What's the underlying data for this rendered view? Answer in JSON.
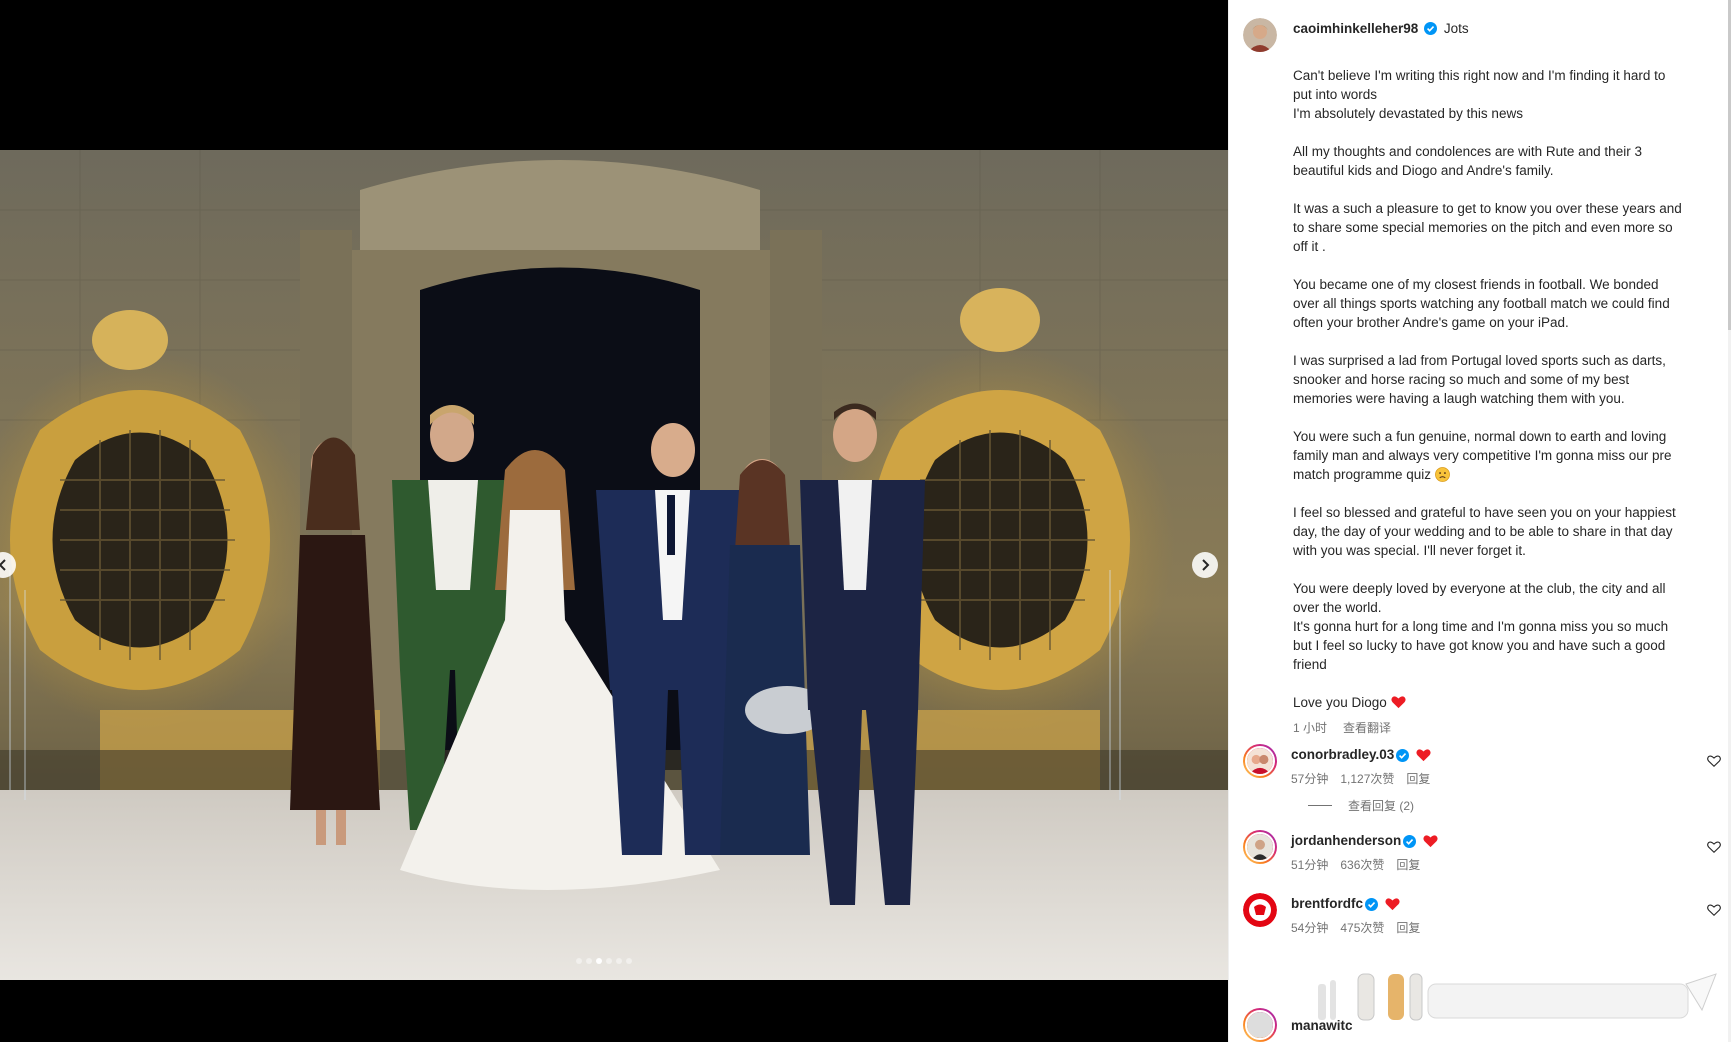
{
  "post": {
    "author": "caoimhinkelleher98",
    "title": "Jots",
    "paragraphs": [
      [
        "Can't believe I'm writing this right now and I'm finding it hard to",
        "put into words",
        "I'm absolutely devastated by this news"
      ],
      [
        "All my thoughts and condolences are with Rute and their 3",
        "beautiful kids and Diogo and Andre's family."
      ],
      [
        "It was a such a pleasure to get to know you over these years and",
        "to share some special memories on the pitch and even more so",
        "off it ."
      ],
      [
        "You became one of my closest friends in football. We bonded",
        "over all things sports watching any football match we could find",
        "often your brother Andre's game on your iPad."
      ],
      [
        "I was surprised a lad from Portugal loved sports such as darts,",
        "snooker and horse racing so much and some of my best",
        "memories were having a laugh watching them with you."
      ],
      [
        "You were such a fun genuine, normal down to earth and loving",
        "family man and always very competitive I'm gonna miss our pre",
        "match programme quiz"
      ],
      [
        "I feel so blessed and grateful to have seen you on your happiest",
        "day, the day of your wedding and to be able to share in that day",
        "with you was special. I'll never forget it."
      ],
      [
        "You were deeply loved by everyone at the club, the city and all",
        "over the world.",
        "It's gonna hurt for a long time and I'm gonna miss you so much",
        "but I feel so lucky to have got know you and have such a good",
        "friend"
      ],
      [
        "Love you Diogo"
      ]
    ],
    "time": "1 小时",
    "translate": "查看翻译"
  },
  "carousel": {
    "count": 6,
    "active_index": 2
  },
  "comments": [
    {
      "user": "conorbradley.03",
      "time": "57分钟",
      "likes": "1,127次赞",
      "reply": "回复",
      "view_replies": "查看回复 (2)"
    },
    {
      "user": "jordanhenderson",
      "time": "51分钟",
      "likes": "636次赞",
      "reply": "回复"
    },
    {
      "user": "brentfordfc",
      "time": "54分钟",
      "likes": "475次赞",
      "reply": "回复"
    }
  ],
  "partial_comment": {
    "user": "manawitc"
  },
  "icons": {
    "verified": "verified-badge-icon",
    "heart": "red-heart-emoji",
    "sad": "sad-face-emoji",
    "like": "heart-outline-icon",
    "prev": "chevron-left-icon",
    "next": "chevron-right-icon"
  },
  "colors": {
    "verified": "#0095f6",
    "heart": "#ed1c24",
    "muted": "#737373",
    "text": "#262626"
  }
}
